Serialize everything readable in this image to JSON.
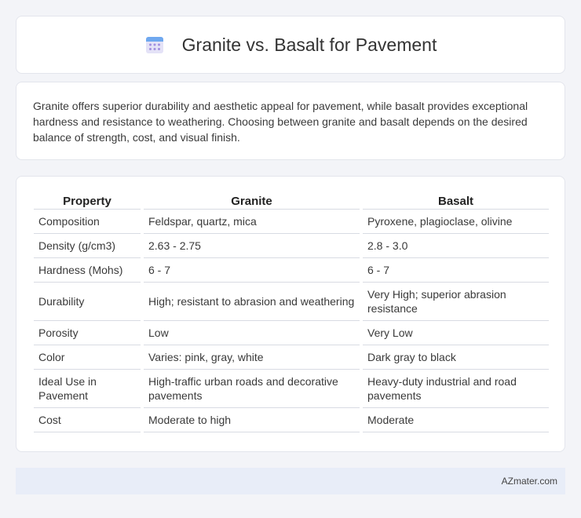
{
  "header": {
    "title": "Granite vs. Basalt for Pavement",
    "icon": "calendar-icon"
  },
  "intro": {
    "text": "Granite offers superior durability and aesthetic appeal for pavement, while basalt provides exceptional hardness and resistance to weathering. Choosing between granite and basalt depends on the desired balance of strength, cost, and visual finish."
  },
  "table": {
    "headers": [
      "Property",
      "Granite",
      "Basalt"
    ],
    "rows": [
      [
        "Composition",
        "Feldspar, quartz, mica",
        "Pyroxene, plagioclase, olivine"
      ],
      [
        "Density (g/cm3)",
        "2.63 - 2.75",
        "2.8 - 3.0"
      ],
      [
        "Hardness (Mohs)",
        "6 - 7",
        "6 - 7"
      ],
      [
        "Durability",
        "High; resistant to abrasion and weathering",
        "Very High; superior abrasion resistance"
      ],
      [
        "Porosity",
        "Low",
        "Very Low"
      ],
      [
        "Color",
        "Varies: pink, gray, white",
        "Dark gray to black"
      ],
      [
        "Ideal Use in Pavement",
        "High-traffic urban roads and decorative pavements",
        "Heavy-duty industrial and road pavements"
      ],
      [
        "Cost",
        "Moderate to high",
        "Moderate"
      ]
    ]
  },
  "footer": {
    "brand": "AZmater.com"
  }
}
